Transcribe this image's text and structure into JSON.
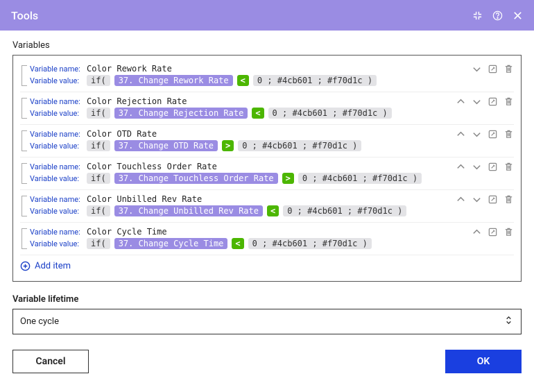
{
  "header": {
    "title": "Tools"
  },
  "sections": {
    "variables_label": "Variables",
    "lifetime_label": "Variable lifetime",
    "lifetime_value": "One cycle",
    "add_item_label": "Add item"
  },
  "labels": {
    "variable_name": "Variable name:",
    "variable_value": "Variable value:"
  },
  "value_tokens": {
    "if_open": "if(",
    "zero_sep": "0 ; #4cb601 ; #f70d1c )"
  },
  "variables": [
    {
      "name": "Color Rework Rate",
      "ref": "37. Change Rework Rate",
      "op": "<",
      "show_up": false,
      "show_down": true
    },
    {
      "name": "Color Rejection Rate",
      "ref": "37. Change Rejection Rate",
      "op": "<",
      "show_up": true,
      "show_down": true
    },
    {
      "name": "Color OTD Rate",
      "ref": "37. Change OTD Rate",
      "op": ">",
      "show_up": true,
      "show_down": true
    },
    {
      "name": "Color Touchless Order Rate",
      "ref": "37. Change Touchless Order Rate",
      "op": ">",
      "show_up": true,
      "show_down": true
    },
    {
      "name": "Color Unbilled Rev Rate",
      "ref": "37. Change Unbilled Rev Rate",
      "op": "<",
      "show_up": true,
      "show_down": true
    },
    {
      "name": "Color Cycle Time",
      "ref": "37. Change Cycle Time",
      "op": "<",
      "show_up": true,
      "show_down": false
    }
  ],
  "footer": {
    "cancel": "Cancel",
    "ok": "OK"
  }
}
